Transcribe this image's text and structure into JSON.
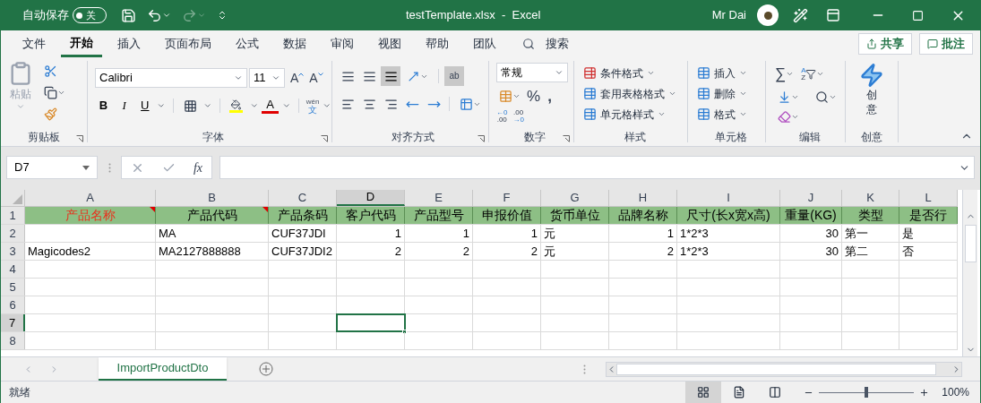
{
  "title_bar": {
    "autosave_label": "自动保存",
    "autosave": {
      "on": false,
      "label": "关"
    },
    "title": "testTemplate.xlsx  -  Excel",
    "user": "Mr Dai"
  },
  "tabs": [
    {
      "label": "文件",
      "selected": false
    },
    {
      "label": "开始",
      "selected": true
    },
    {
      "label": "插入",
      "selected": false
    },
    {
      "label": "页面布局",
      "selected": false
    },
    {
      "label": "公式",
      "selected": false
    },
    {
      "label": "数据",
      "selected": false
    },
    {
      "label": "审阅",
      "selected": false
    },
    {
      "label": "视图",
      "selected": false
    },
    {
      "label": "帮助",
      "selected": false
    },
    {
      "label": "团队",
      "selected": false
    }
  ],
  "search": {
    "label": "搜索"
  },
  "share": "共享",
  "comments": "批注",
  "ribbon": {
    "clipboard": {
      "label": "剪贴板",
      "paste": "粘贴"
    },
    "font": {
      "label": "字体",
      "name": "Calibri",
      "size": "11",
      "grow": "A",
      "shrink": "A",
      "bold": "B",
      "italic": "I",
      "underline": "U",
      "font_color": "A",
      "phonetic_top": "wén",
      "phonetic_bottom": "文"
    },
    "alignment": {
      "label": "对齐方式",
      "wrap_text": "ab"
    },
    "number": {
      "label": "数字",
      "format": "常规",
      "percent": "%",
      "comma": ",",
      "decimal_increase": [
        "←0",
        ".00"
      ],
      "decimal_decrease": [
        ".00",
        "→0"
      ]
    },
    "styles": {
      "label": "样式",
      "items": [
        "条件格式",
        "套用表格格式",
        "单元格样式"
      ]
    },
    "cells": {
      "label": "单元格",
      "items": [
        "插入",
        "删除",
        "格式"
      ]
    },
    "editing": {
      "label": "编辑",
      "autosum": "∑",
      "sort": [
        "A",
        "Z"
      ]
    },
    "ideas": {
      "label": "创意",
      "button": "创意"
    }
  },
  "formula_bar": {
    "name_box": "D7",
    "fx": "fx"
  },
  "sheet": {
    "columns": [
      {
        "label": "A",
        "selected": false
      },
      {
        "label": "B",
        "selected": false
      },
      {
        "label": "C",
        "selected": false
      },
      {
        "label": "D",
        "selected": true
      },
      {
        "label": "E",
        "selected": false
      },
      {
        "label": "F",
        "selected": false
      },
      {
        "label": "G",
        "selected": false
      },
      {
        "label": "H",
        "selected": false
      },
      {
        "label": "I",
        "selected": false
      },
      {
        "label": "J",
        "selected": false
      },
      {
        "label": "K",
        "selected": false
      },
      {
        "label": "L",
        "selected": false
      }
    ],
    "rows": [
      {
        "label": "1",
        "selected": false,
        "cells": [
          {
            "text": "产品名称",
            "kind": "header",
            "required": true,
            "comment": true
          },
          {
            "text": "产品代码",
            "kind": "header",
            "required": false,
            "comment": true
          },
          {
            "text": "产品条码",
            "kind": "header",
            "required": false,
            "comment": false
          },
          {
            "text": "客户代码",
            "kind": "header",
            "required": false,
            "comment": false
          },
          {
            "text": "产品型号",
            "kind": "header",
            "required": false,
            "comment": false
          },
          {
            "text": "申报价值",
            "kind": "header",
            "required": false,
            "comment": false
          },
          {
            "text": "货币单位",
            "kind": "header",
            "required": false,
            "comment": false
          },
          {
            "text": "品牌名称",
            "kind": "header",
            "required": false,
            "comment": false
          },
          {
            "text": "尺寸(长x宽x高)",
            "kind": "header",
            "required": false,
            "comment": false
          },
          {
            "text": "重量(KG)",
            "kind": "header",
            "required": false,
            "comment": false
          },
          {
            "text": "类型",
            "kind": "header",
            "required": false,
            "comment": false
          },
          {
            "text": "是否行",
            "kind": "header",
            "required": false,
            "comment": false
          }
        ]
      },
      {
        "label": "2",
        "selected": false,
        "cells": [
          null,
          {
            "text": "MA",
            "kind": "text"
          },
          {
            "text": "CUF37JDI",
            "kind": "text"
          },
          {
            "text": "1",
            "kind": "number"
          },
          {
            "text": "1",
            "kind": "number"
          },
          {
            "text": "1",
            "kind": "number"
          },
          {
            "text": "元",
            "kind": "text"
          },
          {
            "text": "1",
            "kind": "number"
          },
          {
            "text": "1*2*3",
            "kind": "text"
          },
          {
            "text": "30",
            "kind": "number"
          },
          {
            "text": "第一",
            "kind": "text"
          },
          {
            "text": "是",
            "kind": "text"
          }
        ]
      },
      {
        "label": "3",
        "selected": false,
        "cells": [
          {
            "text": "Magicodes2",
            "kind": "text"
          },
          {
            "text": "MA2127888888",
            "kind": "text"
          },
          {
            "text": "CUF37JDI2",
            "kind": "text"
          },
          {
            "text": "2",
            "kind": "number"
          },
          {
            "text": "2",
            "kind": "number"
          },
          {
            "text": "2",
            "kind": "number"
          },
          {
            "text": "元",
            "kind": "text"
          },
          {
            "text": "2",
            "kind": "number"
          },
          {
            "text": "1*2*3",
            "kind": "text"
          },
          {
            "text": "30",
            "kind": "number"
          },
          {
            "text": "第二",
            "kind": "text"
          },
          {
            "text": "否",
            "kind": "text"
          }
        ]
      },
      {
        "label": "4",
        "selected": false
      },
      {
        "label": "5",
        "selected": false
      },
      {
        "label": "6",
        "selected": false
      },
      {
        "label": "7",
        "selected": true
      },
      {
        "label": "8",
        "selected": false
      }
    ]
  },
  "sheet_tabs": [
    {
      "label": "ImportProductDto",
      "selected": true
    }
  ],
  "status_bar": {
    "text": "就绪",
    "views": [
      {
        "kind": "normal",
        "selected": true
      },
      {
        "kind": "page_layout",
        "selected": false
      },
      {
        "kind": "page_break",
        "selected": false
      }
    ],
    "zoom": {
      "level": 0.5,
      "label": "100%"
    }
  }
}
